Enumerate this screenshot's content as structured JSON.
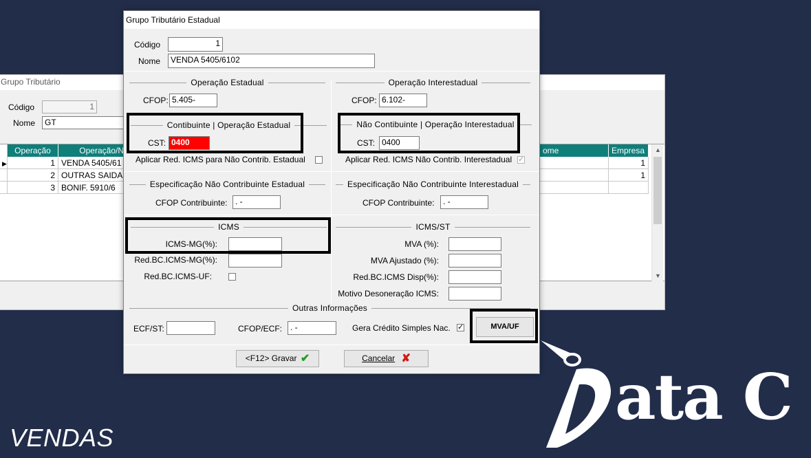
{
  "background_window": {
    "title": "Grupo Tributário",
    "codigo_label": "Código",
    "codigo_value": "1",
    "nome_label": "Nome",
    "nome_value": "GT",
    "columns": [
      "Operação",
      "Operação/N",
      "ome",
      "Empresa"
    ],
    "rows": [
      {
        "operacao": "1",
        "descricao": "VENDA 5405/61",
        "empresa": "1"
      },
      {
        "operacao": "2",
        "descricao": "OUTRAS SAIDA",
        "empresa": "1"
      },
      {
        "operacao": "3",
        "descricao": "BONIF. 5910/6",
        "empresa": ""
      }
    ]
  },
  "dialog": {
    "title": "Grupo Tributário Estadual",
    "codigo_label": "Código",
    "codigo_value": "1",
    "nome_label": "Nome",
    "nome_value": "VENDA 5405/6102",
    "op_estadual": {
      "heading": "Operação Estadual",
      "cfop_label": "CFOP:",
      "cfop_value": "5.405-",
      "contrib_heading": "Contibuinte | Operação Estadual",
      "cst_label": "CST:",
      "cst_value": "0400",
      "aplicar_label": "Aplicar Red. ICMS para Não Contrib. Estadual"
    },
    "op_interestadual": {
      "heading": "Operação Interestadual",
      "cfop_label": "CFOP:",
      "cfop_value": "6.102-",
      "contrib_heading": "Não Contibuinte | Operação Interestadual",
      "cst_label": "CST:",
      "cst_value": "0400",
      "aplicar_label": "Aplicar Red. ICMS Não Contrib. Interestadual"
    },
    "espec_estadual": {
      "heading": "Especificação Não Contribuinte Estadual",
      "cfop_label": "CFOP Contribuinte:",
      "cfop_value": ".  -"
    },
    "espec_interestadual": {
      "heading": "Especificação Não Contribuinte Interestadual",
      "cfop_label": "CFOP Contribuinte:",
      "cfop_value": ".  -"
    },
    "icms": {
      "heading": "ICMS",
      "icms_mg_label": "ICMS-MG(%):",
      "red_bc_mg_label": "Red.BC.ICMS-MG(%):",
      "red_bc_uf_label": "Red.BC.ICMS-UF:"
    },
    "icms_st": {
      "heading": "ICMS/ST",
      "mva_label": "MVA (%):",
      "mva_ajustado_label": "MVA Ajustado (%):",
      "red_bc_disp_label": "Red.BC.ICMS Disp(%):",
      "motivo_label": "Motivo Desoneração ICMS:"
    },
    "outras": {
      "heading": "Outras Informações",
      "ecf_st_label": "ECF/ST:",
      "cfop_ecf_label": "CFOP/ECF:",
      "cfop_ecf_value": ".  -",
      "gera_credito_label": "Gera Crédito Simples Nac.",
      "mva_uf_button": "MVA/UF"
    },
    "gravar_button": "<F12> Gravar",
    "cancelar_button": "Cancelar"
  },
  "branding": {
    "caption": "VENDAS",
    "logo_text": "Data C"
  },
  "colors": {
    "background": "#222d4a",
    "grid_header": "#0f7f7a",
    "cst_highlight": "#ff0000",
    "gravar_check": "#1e9e1e",
    "cancelar_x": "#d01818"
  }
}
